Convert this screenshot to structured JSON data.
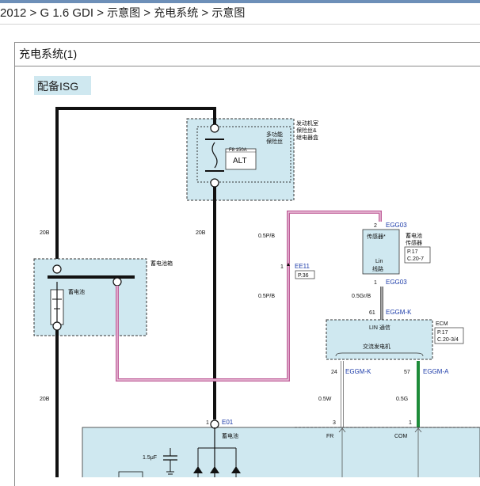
{
  "breadcrumb": {
    "root": "2012",
    "model": "G 1.6 GDI",
    "l1": "示意图",
    "l2": "充电系统",
    "l3": "示意图",
    "sep": ">"
  },
  "diagram": {
    "title": "充电系统(1)",
    "variant": "配备ISG",
    "engine_box": {
      "label1": "发动机室",
      "label2": "保险丝&",
      "label3": "继电器盒",
      "sub1": "多功能",
      "sub2": "保险丝",
      "fuse_rating": "F8 150A",
      "fuse_name": "ALT"
    },
    "battery_box": {
      "label": "蓄电池箱",
      "battery": "蓄电池"
    },
    "sensor": {
      "pin_top": "2",
      "conn_top": "EGG03",
      "name": "传感器*",
      "side1": "蓄电池",
      "side2": "传感器",
      "ref1": "P.17",
      "ref2": "C.20-7",
      "inner1": "Lin",
      "inner2": "线路",
      "pin_bottom": "1",
      "conn_bottom": "EGG03"
    },
    "joint": {
      "pin": "1",
      "name": "EE11",
      "ref": "P.36"
    },
    "ecm": {
      "pin": "61",
      "conn": "EGGM-K",
      "lin": "LIN 通信",
      "label": "ECM",
      "ref1": "P.17",
      "ref2": "C.20-3/4",
      "alt": "交流发电机",
      "pin_a": "24",
      "conn_a": "EGGM-K",
      "pin_b": "57",
      "conn_b": "EGGM-A"
    },
    "wires": {
      "w1": "20B",
      "w2": "20B",
      "w3": "20B",
      "w4": "0.5P/B",
      "w5": "0.5P/B",
      "w6": "0.5Gr/B",
      "w7": "0.5W",
      "w8": "0.5G"
    },
    "alternator": {
      "pin_main": "1",
      "conn_main": "E01",
      "battery_label": "蓄电池",
      "cap": "1.5μF",
      "pin_fr": "3",
      "fr": "FR",
      "pin_com": "1",
      "com": "COM"
    },
    "colors": {
      "box_fill": "#cfe8f0",
      "pink_wire": "#c0609a",
      "green_wire": "#1e8c3a",
      "blue_text": "#1b3aa8"
    }
  }
}
